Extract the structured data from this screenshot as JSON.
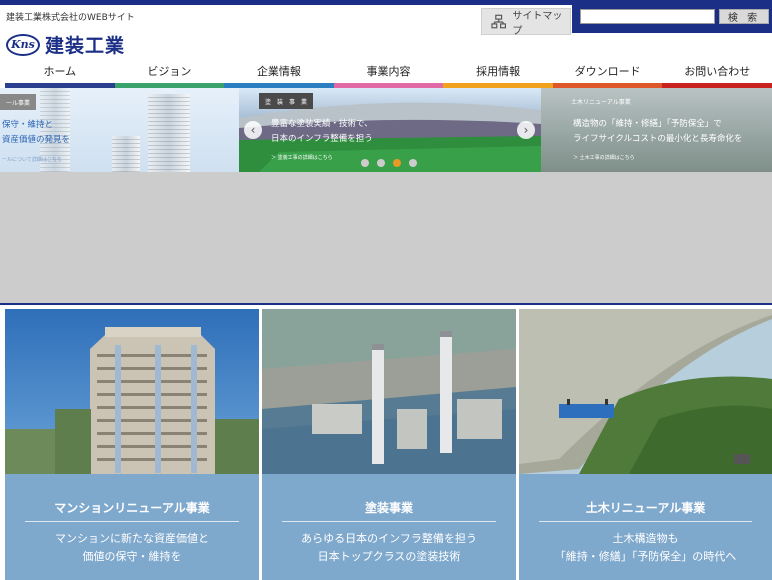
{
  "header": {
    "tagline": "建装工業株式会社のWEBサイト",
    "logo_mark": "Kns",
    "logo_name": "建装工業",
    "sitemap_label": "サイトマップ",
    "search": {
      "placeholder": "",
      "button_label": "検 索"
    }
  },
  "nav": {
    "items": [
      {
        "label": "ホーム",
        "color": "#2a3f8f"
      },
      {
        "label": "ビジョン",
        "color": "#3aa36b"
      },
      {
        "label": "企業情報",
        "color": "#2b7fc1"
      },
      {
        "label": "事業内容",
        "color": "#e06aa6"
      },
      {
        "label": "採用情報",
        "color": "#f0a21c"
      },
      {
        "label": "ダウンロード",
        "color": "#e0562b"
      },
      {
        "label": "お問い合わせ",
        "color": "#c8231e"
      }
    ]
  },
  "hero": {
    "slides": [
      {
        "tag": "ール事業",
        "heading_1": "保守・維持と",
        "heading_2": "資産価値の発見を",
        "link": "ールについて詳細はこちら"
      },
      {
        "tag": "塗　装　事　業",
        "heading_1": "豊富な塗装実績・技術で、",
        "heading_2": "日本のインフラ整備を担う",
        "link": "＞ 塗装工事の詳細はこちら"
      },
      {
        "tag": "土木リニューアル事業",
        "heading_1": "構造物の「維持・修繕」「予防保全」で",
        "heading_2": "ライフサイクルコストの最小化と長寿命化を",
        "link": "＞ 土木工事の詳細はこちら"
      }
    ],
    "prev_arrow": "‹",
    "next_arrow": "›",
    "active_dot": 2,
    "dot_count": 4
  },
  "cards": [
    {
      "title": "マンションリニューアル事業",
      "desc_1": "マンションに新たな資産価値と",
      "desc_2": "価値の保守・維持を"
    },
    {
      "title": "塗装事業",
      "desc_1": "あらゆる日本のインフラ整備を担う",
      "desc_2": "日本トップクラスの塗装技術"
    },
    {
      "title": "土木リニューアル事業",
      "desc_1": "土木構造物も",
      "desc_2": "「維持・修繕」「予防保全」の時代へ"
    }
  ]
}
